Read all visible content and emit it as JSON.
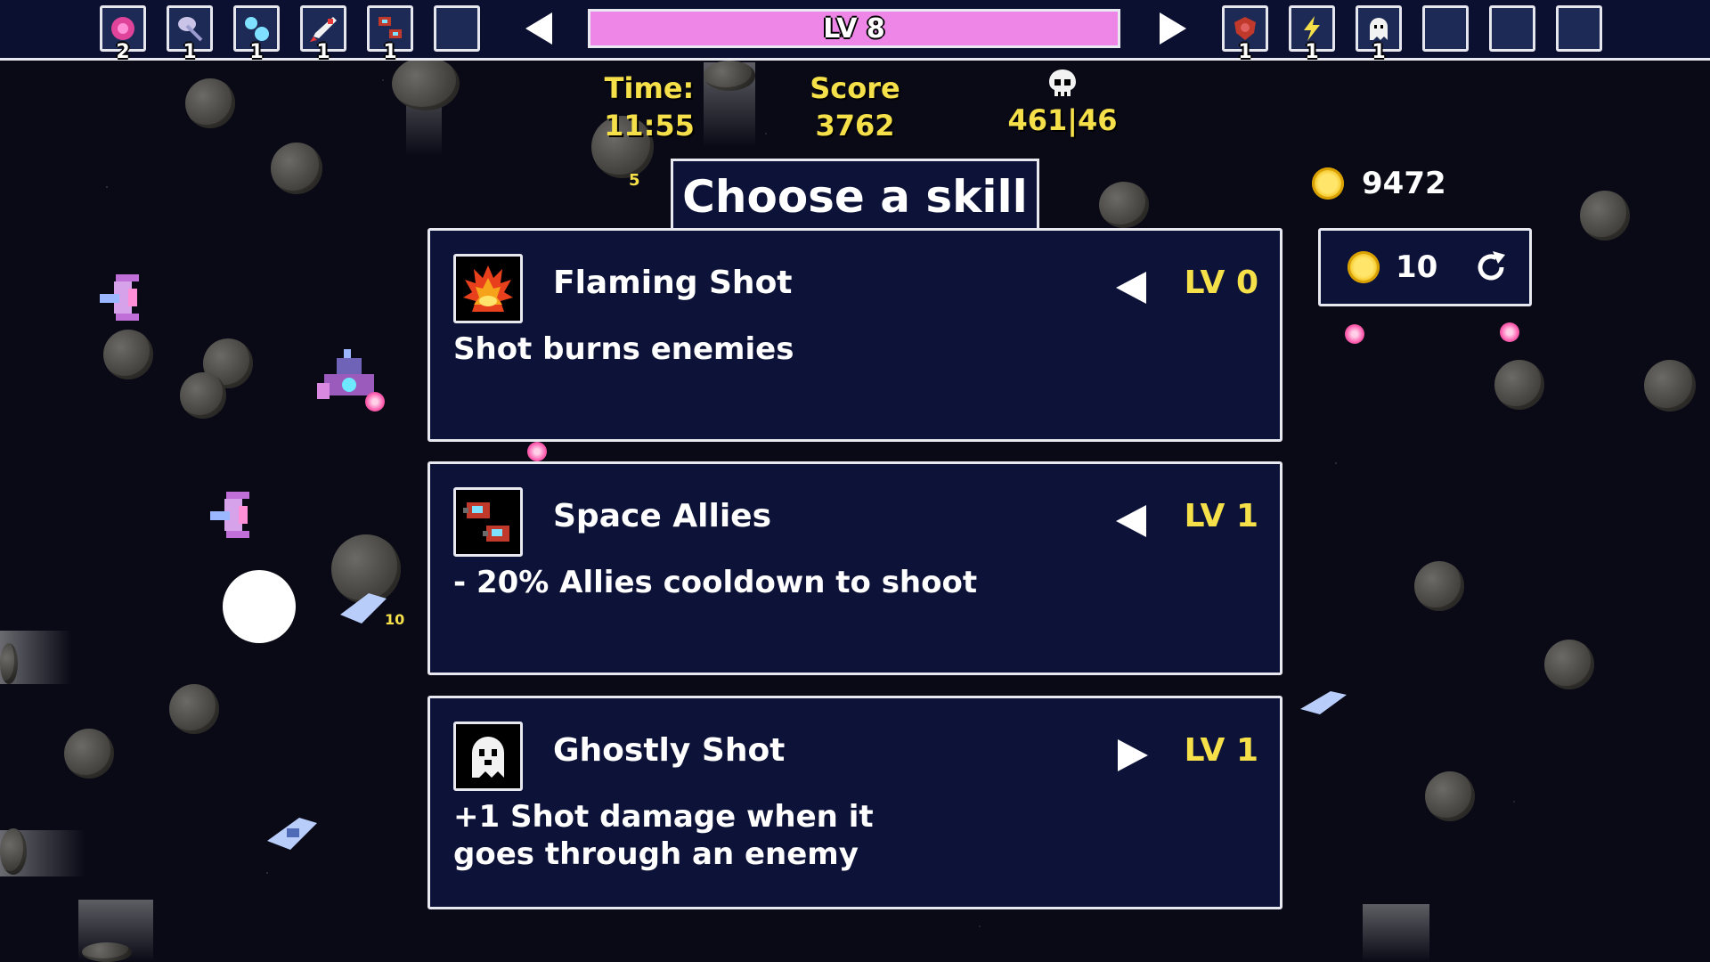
{
  "top_bar": {
    "weapon_slots": [
      {
        "icon": "pink-flower-icon",
        "count": "2"
      },
      {
        "icon": "satellite-dish-icon",
        "count": "1"
      },
      {
        "icon": "blue-orbs-icon",
        "count": "1"
      },
      {
        "icon": "rocket-icon",
        "count": "1"
      },
      {
        "icon": "space-allies-icon",
        "count": "1"
      },
      {
        "icon": "empty-slot-icon",
        "count": ""
      }
    ],
    "level_label": "LV 8",
    "level_progress": 1.0,
    "passive_slots": [
      {
        "icon": "red-shield-icon",
        "count": "1"
      },
      {
        "icon": "lightning-icon",
        "count": "1"
      },
      {
        "icon": "ghost-icon",
        "count": "1"
      },
      {
        "icon": "empty-slot-icon",
        "count": ""
      },
      {
        "icon": "empty-slot-icon",
        "count": ""
      },
      {
        "icon": "empty-slot-icon",
        "count": ""
      }
    ]
  },
  "hud": {
    "time_label": "Time:",
    "time_value": "11:55",
    "score_label": "Score",
    "score_value": "3762",
    "kills_icon": "skull-icon",
    "kills_value": "461|46",
    "coins_value": "9472",
    "reroll_cost": "10",
    "floating_numbers": [
      "5",
      "10"
    ]
  },
  "skill_panel": {
    "title": "Choose a skill",
    "cards": [
      {
        "name": "Flaming Shot",
        "icon": "flame-icon",
        "arrow": "left",
        "level": "LV 0",
        "description": "Shot burns enemies"
      },
      {
        "name": "Space Allies",
        "icon": "space-allies-icon",
        "arrow": "left",
        "level": "LV 1",
        "description": "- 20% Allies cooldown to shoot"
      },
      {
        "name": "Ghostly Shot",
        "icon": "ghost-icon",
        "arrow": "right",
        "level": "LV 1",
        "description": "+1 Shot damage when it\ngoes through an enemy"
      }
    ]
  },
  "colors": {
    "accent_yellow": "#f5e04a",
    "level_bar_pink": "#ee86e7",
    "panel_navy": "#0d1238",
    "border_white": "#e8e8f0"
  }
}
